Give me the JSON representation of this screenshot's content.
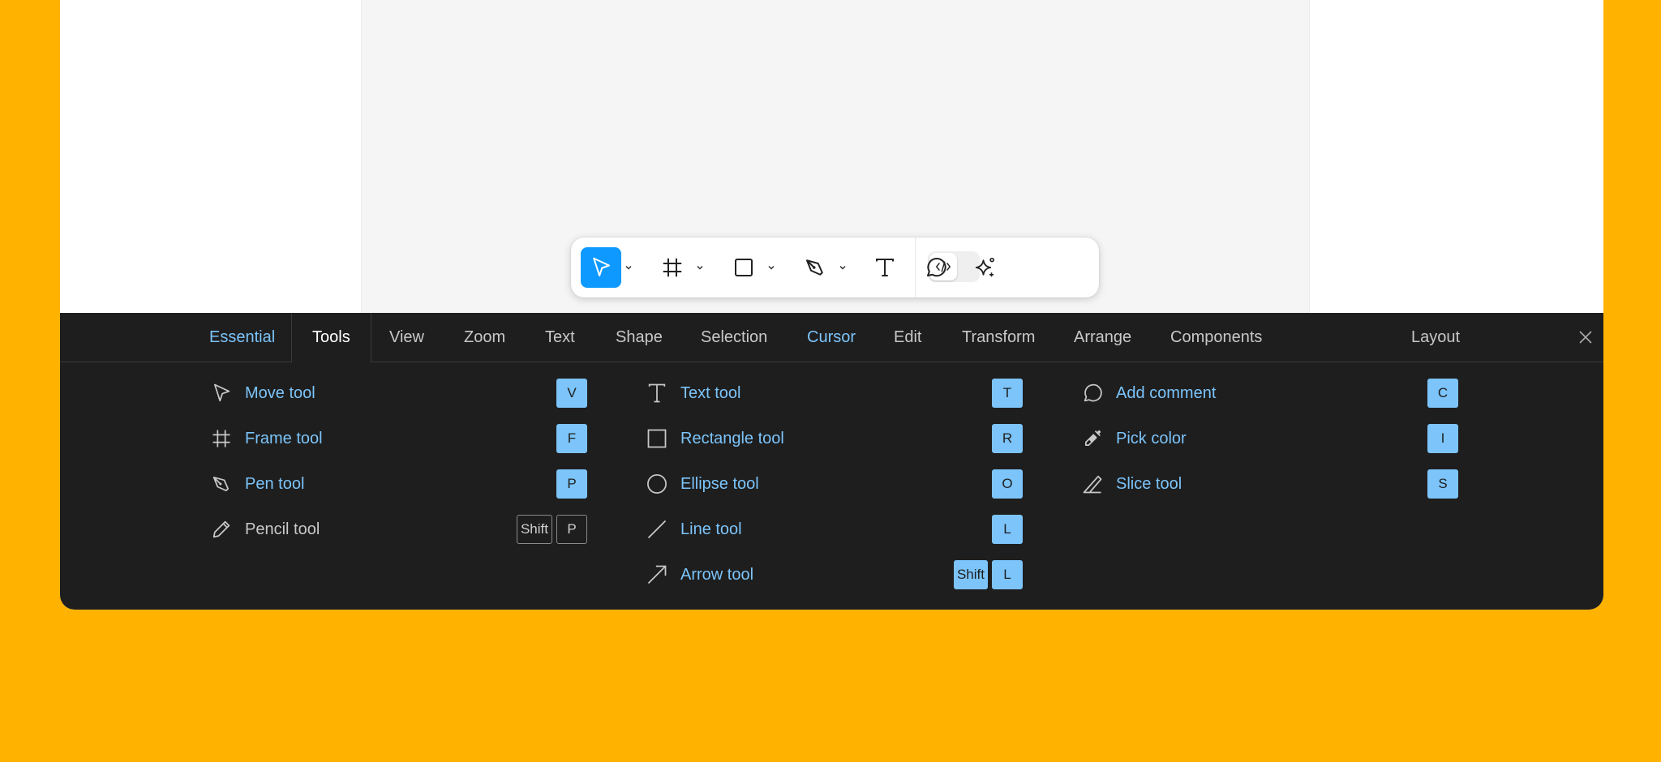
{
  "colors": {
    "background": "#FFB200",
    "accent": "#0D99FF",
    "panel": "#1E1E1E",
    "link": "#7CC4FA"
  },
  "toolbar": {
    "tools": [
      {
        "name": "move",
        "icon": "move-arrow-icon",
        "active": true,
        "has_dropdown": true
      },
      {
        "name": "frame",
        "icon": "frame-hash-icon",
        "has_dropdown": true
      },
      {
        "name": "shape",
        "icon": "rectangle-icon",
        "has_dropdown": true
      },
      {
        "name": "pen",
        "icon": "pen-nib-icon",
        "has_dropdown": true
      },
      {
        "name": "text",
        "icon": "text-t-icon"
      },
      {
        "name": "comment",
        "icon": "comment-bubble-icon"
      },
      {
        "name": "actions",
        "icon": "sparkle-icon"
      }
    ],
    "dev_mode_icon": "code-brackets-icon"
  },
  "panel": {
    "tabs": [
      "Essential",
      "Tools",
      "View",
      "Zoom",
      "Text",
      "Shape",
      "Selection",
      "Cursor",
      "Edit",
      "Transform",
      "Arrange",
      "Components"
    ],
    "active_tab": "Tools",
    "layout_label": "Layout",
    "columns": [
      [
        {
          "label": "Move tool",
          "icon": "move-arrow-icon",
          "keys": [
            "V"
          ]
        },
        {
          "label": "Frame tool",
          "icon": "frame-hash-icon",
          "keys": [
            "F"
          ]
        },
        {
          "label": "Pen tool",
          "icon": "pen-nib-icon",
          "keys": [
            "P"
          ]
        },
        {
          "label": "Pencil tool",
          "icon": "pencil-icon",
          "keys": [
            "Shift",
            "P"
          ],
          "learned": false
        }
      ],
      [
        {
          "label": "Text tool",
          "icon": "text-t-icon",
          "keys": [
            "T"
          ]
        },
        {
          "label": "Rectangle tool",
          "icon": "rectangle-icon",
          "keys": [
            "R"
          ]
        },
        {
          "label": "Ellipse tool",
          "icon": "ellipse-icon",
          "keys": [
            "O"
          ]
        },
        {
          "label": "Line tool",
          "icon": "line-icon",
          "keys": [
            "L"
          ]
        },
        {
          "label": "Arrow tool",
          "icon": "arrow-diagonal-icon",
          "keys": [
            "Shift",
            "L"
          ]
        }
      ],
      [
        {
          "label": "Add comment",
          "icon": "comment-bubble-icon",
          "keys": [
            "C"
          ]
        },
        {
          "label": "Pick color",
          "icon": "eyedropper-icon",
          "keys": [
            "I"
          ]
        },
        {
          "label": "Slice tool",
          "icon": "slice-knife-icon",
          "keys": [
            "S"
          ]
        }
      ]
    ]
  }
}
